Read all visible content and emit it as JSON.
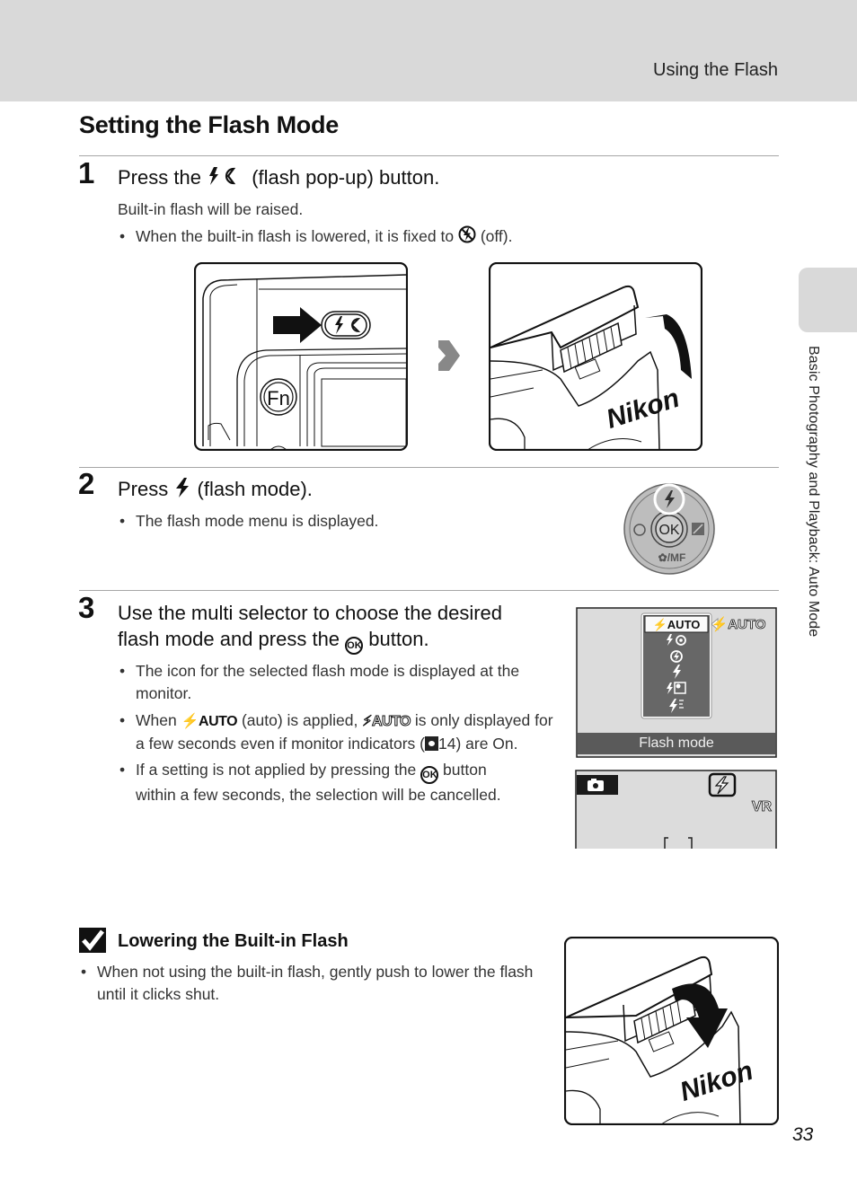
{
  "header": {
    "section_title": "Using the Flash"
  },
  "page_title": "Setting the Flash Mode",
  "side_tab": {
    "label": "Basic Photography and Playback: Auto Mode"
  },
  "steps": [
    {
      "number": "1",
      "title_before": "Press the",
      "title_icon": "flash-popup-icon",
      "title_after": "(flash pop-up) button.",
      "text": "Built-in flash will be raised.",
      "bullets": [
        {
          "before": "When the built-in flash is lowered, it is fixed to",
          "icon": "flash-off-icon",
          "after": "(off)."
        }
      ],
      "illustration": {
        "camera_button_label": "Fn",
        "brand": "Nikon"
      }
    },
    {
      "number": "2",
      "title_before": "Press",
      "title_icon": "flash-icon",
      "title_after": "(flash mode).",
      "bullets": [
        {
          "text": "The flash mode menu is displayed."
        }
      ],
      "multi_selector": {
        "center": "OK",
        "bottom": "/MF"
      }
    },
    {
      "number": "3",
      "title_line1": "Use the multi selector to choose the desired",
      "title_line2_before": "flash mode and press the",
      "title_line2_icon": "ok-button-icon",
      "title_line2_after": "button.",
      "bullets": [
        {
          "line1": "The icon for the selected flash mode is displayed at the",
          "line2": "monitor."
        },
        {
          "l1_a": "When",
          "auto_badge": "AUTO",
          "l1_b": "(auto) is applied,",
          "l1_c": "is only displayed for",
          "line2_a": "a few seconds even if monitor indicators (",
          "ref_page": "14",
          "line2_b": ") are On."
        },
        {
          "l1_a": "If a setting is not applied by pressing the",
          "l1_b": "button",
          "line2": "within a few seconds, the selection will be cancelled."
        }
      ],
      "lcd_menu": {
        "label": "Flash mode",
        "selected": "AUTO",
        "items": [
          "AUTO",
          "red-eye",
          "off",
          "fill",
          "slow-sync",
          "rear-curtain"
        ]
      }
    }
  ],
  "note": {
    "title": "Lowering the Built-in Flash",
    "bullet_line1": "When not using the built-in flash, gently push to lower the flash",
    "bullet_line2": "until it clicks shut."
  },
  "page_number": "33",
  "colors": {
    "header_band": "#d9d9d9",
    "rule": "#a6a6a6",
    "lcd_bg": "#dcdcdc",
    "lcd_menu": "#666666"
  }
}
